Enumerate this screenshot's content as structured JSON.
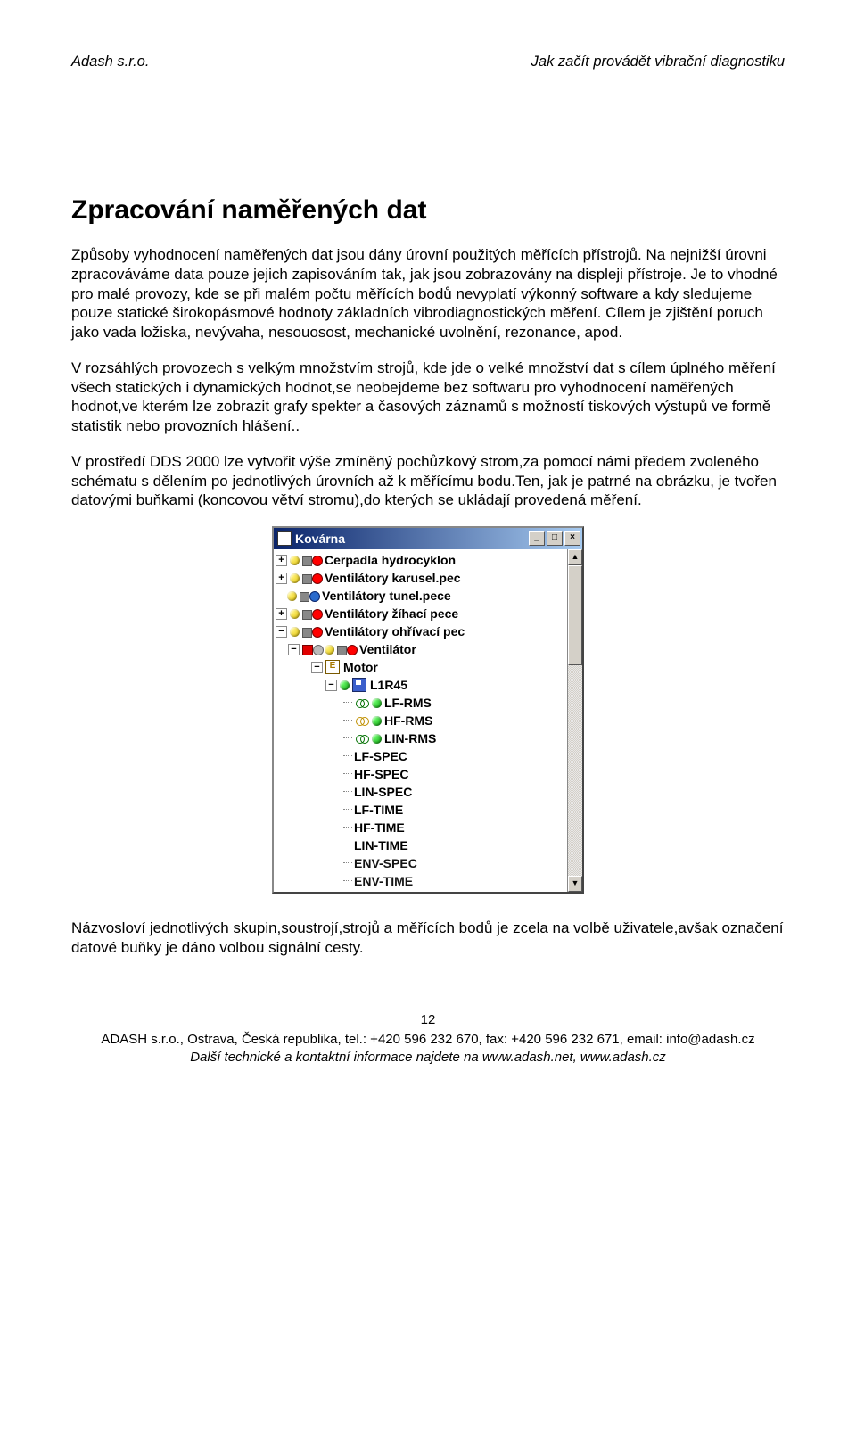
{
  "header": {
    "left": "Adash s.r.o.",
    "right": "Jak začít provádět vibrační diagnostiku"
  },
  "title": "Zpracování naměřených dat",
  "paragraphs": {
    "p1": "Způsoby vyhodnocení naměřených dat jsou dány úrovní použitých měřících přístrojů. Na nejnižší úrovni zpracováváme data pouze jejich zapisováním tak, jak jsou zobrazovány na displeji přístroje. Je to vhodné pro malé provozy, kde se při malém počtu měřících bodů nevyplatí výkonný software a kdy sledujeme pouze statické širokopásmové hodnoty základních vibrodiagnostických měření. Cílem je zjištění poruch jako vada ložiska, nevývaha, nesouosost, mechanické uvolnění, rezonance, apod.",
    "p2": "V rozsáhlých provozech s velkým množstvím strojů, kde jde o velké množství dat s cílem úplného měření všech statických i dynamických hodnot,se neobejdeme bez softwaru pro vyhodnocení naměřených hodnot,ve kterém lze zobrazit grafy spekter a časových záznamů s možností tiskových výstupů ve formě statistik nebo provozních hlášení..",
    "p3": "V  prostředí DDS 2000 lze vytvořit výše zmíněný pochůzkový strom,za pomocí námi předem zvoleného schématu s dělením po jednotlivých úrovních až k měřícímu bodu.Ten, jak je patrné na obrázku, je tvořen datovými buňkami (koncovou větví stromu),do kterých se ukládají provedená měření.",
    "p4": "Názvosloví jednotlivých skupin,soustrojí,strojů a měřících bodů je zcela na volbě uživatele,avšak označení datové buňky je dáno volbou signální cesty."
  },
  "tree": {
    "title": "Kovárna",
    "btn_min": "_",
    "btn_max": "□",
    "btn_close": "×",
    "items": [
      {
        "label": "Cerpadla hydrocyklon"
      },
      {
        "label": "Ventilátory karusel.pec"
      },
      {
        "label": "Ventilátory tunel.pece"
      },
      {
        "label": "Ventilátory žíhací pece"
      },
      {
        "label": "Ventilátory ohřívací pec"
      }
    ],
    "sub": {
      "ventilator": "Ventilátor",
      "motor": "Motor",
      "point": "L1R45",
      "leaves": [
        {
          "label": "LF-RMS",
          "icon": "rings-green",
          "ball": "green"
        },
        {
          "label": "HF-RMS",
          "icon": "rings-yellow",
          "ball": "green"
        },
        {
          "label": "LIN-RMS",
          "icon": "rings-green",
          "ball": "green"
        },
        {
          "label": "LF-SPEC"
        },
        {
          "label": "HF-SPEC"
        },
        {
          "label": "LIN-SPEC"
        },
        {
          "label": "LF-TIME"
        },
        {
          "label": "HF-TIME"
        },
        {
          "label": "LIN-TIME"
        },
        {
          "label": "ENV-SPEC"
        },
        {
          "label": "ENV-TIME"
        }
      ]
    }
  },
  "footer": {
    "pagenum": "12",
    "line1": "ADASH s.r.o., Ostrava, Česká republika, tel.: +420 596 232 670, fax: +420 596 232 671, email: info@adash.cz",
    "line2": "Další technické a kontaktní informace najdete na www.adash.net, www.adash.cz"
  }
}
